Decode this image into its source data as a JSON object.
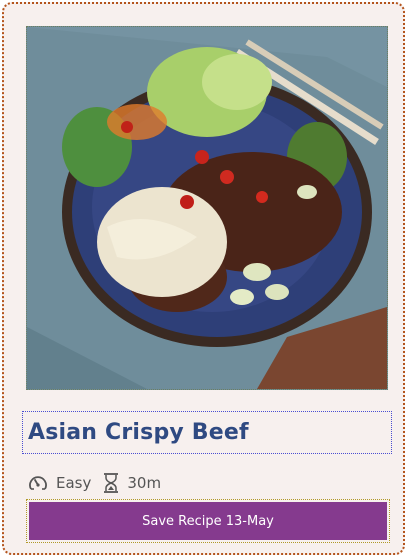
{
  "recipe": {
    "title": "Asian Crispy Beef",
    "difficulty": "Easy",
    "time": "30m",
    "save_button_label": "Save Recipe 13-May"
  },
  "icons": {
    "difficulty": "gauge-icon",
    "time": "hourglass-icon"
  },
  "colors": {
    "card_border": "#b4541c",
    "card_background": "#f7f0ee",
    "title": "#2f4a82",
    "button": "#853a8e",
    "button_text": "#ffffff"
  }
}
